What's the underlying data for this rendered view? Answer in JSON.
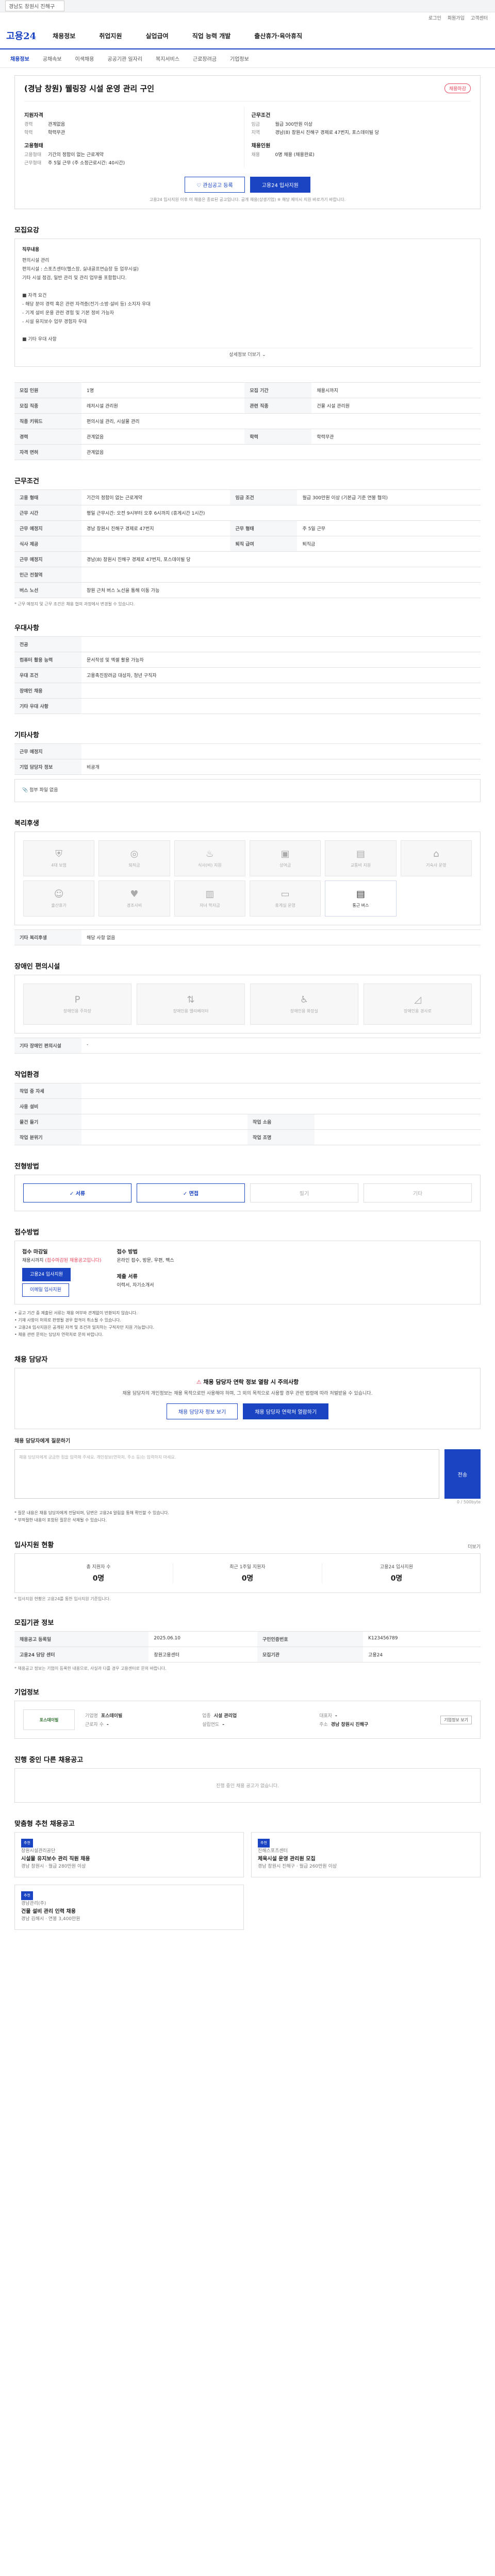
{
  "topbar": {
    "region_select": "경남도 창원시 진해구"
  },
  "util": {
    "items": [
      "로그인",
      "회원가입",
      "고객센터"
    ]
  },
  "header": {
    "logo": "고용24",
    "gnb": [
      "채용정보",
      "취업지원",
      "실업급여",
      "직업 능력 개발",
      "출산휴가·육아휴직"
    ]
  },
  "subnav": {
    "items": [
      "채용정보",
      "공채속보",
      "이색채용",
      "공공기관 일자리",
      "복지서비스",
      "근로장려금",
      "기업정보"
    ]
  },
  "title": {
    "text": "(경남 창원) 웰링장 시설 운영 관리 구인",
    "close_badge": "채용마감"
  },
  "summary": {
    "left_h1": "지원자격",
    "left_rows": [
      {
        "k": "경력",
        "v": "관계없음"
      },
      {
        "k": "학력",
        "v": "학력무관"
      }
    ],
    "left_h2": "고용형태",
    "left_rows2": [
      {
        "k": "고용형태",
        "v": "기간의 정함이 없는 근로계약"
      },
      {
        "k": "근무형태",
        "v": "주 5일 근무 (주 소정근로시간: 40시간)"
      }
    ],
    "right_h1": "근무조건",
    "right_rows": [
      {
        "k": "임금",
        "v": "월급 300만원 이상"
      },
      {
        "k": "지역",
        "v": "경남(8) 창원시 진해구 경제로 47번지, 포스데이빌 당"
      }
    ],
    "right_h2": "채용인원",
    "right_rows2": [
      {
        "k": "채용",
        "v": "0명 채용 (채용완료)"
      }
    ]
  },
  "actions": {
    "scrap": "관심공고 등록",
    "apply": "고용24 입사지원",
    "notice": "고용24 입사지원 이후 이 채용은 종료된 공고입니다. 공개 채용(상생기업) ※ 해당 제이시 지원 바로가기 바랍니다."
  },
  "jd": {
    "title": "모집요강",
    "head": "직무내용",
    "lines": [
      "편의시설 관리",
      "편의시설 : 스포츠센터(헬스장, 실내골프연습장 등 업무시설)",
      "기타 시설 점검, 일반 관리 및 관리 업무를 포함합니다.",
      "",
      "■ 자격 요건",
      " - 해당 분야 경력 혹은 관련 자격증(전기·소방·설비 등) 소지자 우대",
      " - 기계 설비 운용 관련 경험 및 기본 정비 가능자",
      " - 시설 유지보수 업무 경험자 우대",
      "",
      "■ 기타 우대 사항"
    ],
    "more": "상세정보 더보기"
  },
  "details": {
    "rows": [
      {
        "k1": "모집 인원",
        "v1": "1명",
        "k2": "모집 기간",
        "v2": "채용시까지"
      },
      {
        "k1": "모집 직종",
        "v1": "레저시설 관리원",
        "k2": "관련 직종",
        "v2": "건물 시설 관리원"
      },
      {
        "k1": "직종 키워드",
        "v1": "편의시설 관리, 시설물 관리",
        "k2": "",
        "v2": ""
      },
      {
        "k1": "경력",
        "v1": "관계없음",
        "k2": "학력",
        "v2": "학력무관"
      },
      {
        "k1": "자격 면허",
        "v1": "관계없음",
        "k2": "",
        "v2": ""
      }
    ]
  },
  "conditions": {
    "title": "근무조건",
    "rows": [
      {
        "k1": "고용 형태",
        "v1": "기간의 정함이 없는 근로계약",
        "k2": "임금 조건",
        "v2": "월급 300만원 이상 (기본급 기준 연봉 협의)"
      },
      {
        "k1": "근무 시간",
        "v1": "평일 근무시간: 오전 9시부터 오후 6시까지 (휴게시간 1시간)",
        "k2": "",
        "v2": ""
      },
      {
        "k1": "근무 예정지",
        "v1": "경남 창원시 진해구 경제로 47번지",
        "k2": "근무 형태",
        "v2": "주 5일 근무"
      },
      {
        "k1": "식사 제공",
        "v1": "",
        "k2": "퇴직 급여",
        "v2": "퇴직금"
      },
      {
        "k1": "근무 예정지",
        "v1": "경남(8) 창원시 진해구 경제로 47번지, 포스데이빌 당",
        "k2": "",
        "v2": ""
      },
      {
        "k1": "인근 전철역",
        "v1": "",
        "k2": "",
        "v2": ""
      },
      {
        "k1": "버스 노선",
        "v1": "창원 근처 버스 노선을 통해 이동 가능",
        "k2": "",
        "v2": ""
      }
    ],
    "note": "* 근무 예정지 및 근무 조건은 채용 협의 과정에서 변경될 수 있습니다."
  },
  "process": {
    "title": "우대사항",
    "rows": [
      {
        "k": "전공",
        "v": ""
      },
      {
        "k": "컴퓨터 활용 능력",
        "v": "문서작성 및 엑셀 활용 가능자"
      },
      {
        "k": "우대 조건",
        "v": "고용촉진장려금 대상자, 청년 구직자"
      },
      {
        "k": "장애인 채용",
        "v": ""
      },
      {
        "k": "기타 우대 사항",
        "v": ""
      }
    ]
  },
  "etc": {
    "title": "기타사항",
    "rows": [
      {
        "k": "근무 예정지",
        "v": ""
      },
      {
        "k": "기업 담당자 정보",
        "v": "비공개"
      }
    ]
  },
  "attach": {
    "label": "첨부 파일 없음"
  },
  "welfare": {
    "title": "복리후생",
    "items": [
      {
        "name": "4대 보험",
        "icon": "shield-icon",
        "on": false
      },
      {
        "name": "퇴직금",
        "icon": "coin-icon",
        "on": false
      },
      {
        "name": "식사(비) 지원",
        "icon": "meal-icon",
        "on": false
      },
      {
        "name": "상여금",
        "icon": "gift-icon",
        "on": false
      },
      {
        "name": "교통비 지원",
        "icon": "bus-icon",
        "on": false
      },
      {
        "name": "기숙사 운영",
        "icon": "home-icon",
        "on": false
      },
      {
        "name": "출산휴가",
        "icon": "baby-icon",
        "on": false
      },
      {
        "name": "경조사비",
        "icon": "heart-icon",
        "on": false
      },
      {
        "name": "자녀 학자금",
        "icon": "book-icon",
        "on": false
      },
      {
        "name": "휴게실 운영",
        "icon": "sofa-icon",
        "on": false
      },
      {
        "name": "통근 버스",
        "icon": "bus-icon",
        "on": true
      }
    ],
    "extra_label": "기타 복리후생",
    "extra_value": "해당 사항 없음"
  },
  "disability": {
    "title": "장애인 편의시설",
    "items": [
      "장애인용 주차장",
      "장애인용 엘리베이터",
      "장애인용 화장실",
      "장애인용 경사로"
    ],
    "extra_label": "기타 장애인 편의시설",
    "extra_value": "-"
  },
  "workenv": {
    "title": "작업환경",
    "rows": [
      {
        "k1": "작업 중 자세",
        "v1": "",
        "k2": "",
        "v2": ""
      },
      {
        "k1": "사용 설비",
        "v1": "",
        "k2": "",
        "v2": ""
      },
      {
        "k1": "물건 들기",
        "v1": "",
        "k2": "작업 소음",
        "v2": ""
      },
      {
        "k1": "작업 분위기",
        "v1": "",
        "k2": "작업 조명",
        "v2": ""
      }
    ]
  },
  "methods": {
    "title": "전형방법",
    "items": [
      {
        "name": "서류",
        "on": true
      },
      {
        "name": "면접",
        "on": true
      },
      {
        "name": "필기",
        "on": false
      },
      {
        "name": "기타",
        "on": false
      }
    ]
  },
  "apply": {
    "title": "접수방법",
    "deadline_label": "접수 마감일",
    "deadline_value": "채용시까지",
    "deadline_note": "(접수마감된 채용공고입니다)",
    "apply_btn": "고용24 입사지원",
    "email_btn": "이메일 입사지원",
    "way_label": "접수 방법",
    "way_value": "온라인 접수, 방문, 우편, 팩스",
    "doc_label": "제출 서류",
    "doc_value": "이력서, 자기소개서",
    "bullets": [
      "• 공고 기간 중 제출된 서류는 채용 여부와 관계없이 반환되지 않습니다.",
      "• 기재 사항이 허위로 판명될 경우 합격이 취소될 수 있습니다.",
      "• 고용24 입사지원은 공개된 자격 및 조건과 일치하는 구직자만 지원 가능합니다.",
      "• 채용 관련 문의는 담당자 연락처로 문의 바랍니다."
    ]
  },
  "manager": {
    "title": "채용 담당자",
    "warn": "채용 담당자 연락 정보 열람 시 주의사항",
    "desc": "채용 담당자의 개인정보는 채용 목적으로만 사용해야 하며, 그 외의 목적으로 사용할 경우 관련 법령에 따라 처벌받을 수 있습니다.",
    "btn1": "채용 담당자 정보 보기",
    "btn2": "채용 담당자 연락처 열람하기",
    "qna_title": "채용 담당자에게 질문하기",
    "qna_placeholder": "채용 담당자에게 궁금한 점을 입력해 주세요. 개인정보(연락처, 주소 등)는 입력하지 마세요.",
    "send": "전송",
    "count": "0 / 500byte",
    "notes": [
      "* 질문 내용은 채용 담당자에게 전달되며, 답변은 고용24 알림을 통해 확인할 수 있습니다.",
      "* 부적절한 내용이 포함된 질문은 삭제될 수 있습니다."
    ]
  },
  "stats": {
    "title": "입사지원 현황",
    "more": "더보기",
    "items": [
      {
        "label": "총 지원자 수",
        "value": "0명"
      },
      {
        "label": "최근 1주일 지원자",
        "value": "0명"
      },
      {
        "label": "고용24 입사지원",
        "value": "0명"
      }
    ],
    "note": "* 입사지원 현황은 고용24를 통한 입사지원 기준입니다."
  },
  "info": {
    "title": "모집기관 정보",
    "rows": [
      {
        "k1": "채용공고 등록일",
        "v1": "2025.06.10",
        "k2": "구인인증번호",
        "v2": "K123456789"
      },
      {
        "k1": "고용24 담당 센터",
        "v1": "창원고용센터",
        "k2": "모집기관",
        "v2": "고용24"
      }
    ],
    "note": "* 채용공고 정보는 기업이 등록한 내용으로, 사실과 다를 경우 고용센터로 문의 바랍니다."
  },
  "company": {
    "title": "기업정보",
    "logo_text": "포스데이빌",
    "btn": "기업정보 보기",
    "fields": [
      {
        "k": "기업명",
        "v": "포스데이빌"
      },
      {
        "k": "업종",
        "v": "시설 관리업"
      },
      {
        "k": "대표자",
        "v": "-"
      },
      {
        "k": "근로자 수",
        "v": "-"
      },
      {
        "k": "설립연도",
        "v": "-"
      },
      {
        "k": "주소",
        "v": "경남 창원시 진해구"
      }
    ]
  },
  "similar": {
    "title": "진행 중인 다른 채용공고",
    "empty": "진행 중인 채용 공고가 없습니다."
  },
  "recommend": {
    "title": "맞춤형 추천 채용공고",
    "cards": [
      {
        "tag": "추천",
        "company": "창원시설관리공단",
        "title": "시설물 유지보수 관리 직원 채용",
        "sub": "경남 창원시 · 월급 280만원 이상"
      },
      {
        "tag": "추천",
        "company": "진해스포츠센터",
        "title": "체육시설 운영 관리원 모집",
        "sub": "경남 창원시 진해구 · 월급 260만원 이상"
      },
      {
        "tag": "추천",
        "company": "경남관리(주)",
        "title": "건물 설비 관리 인력 채용",
        "sub": "경남 김해시 · 연봉 3,400만원"
      }
    ]
  }
}
